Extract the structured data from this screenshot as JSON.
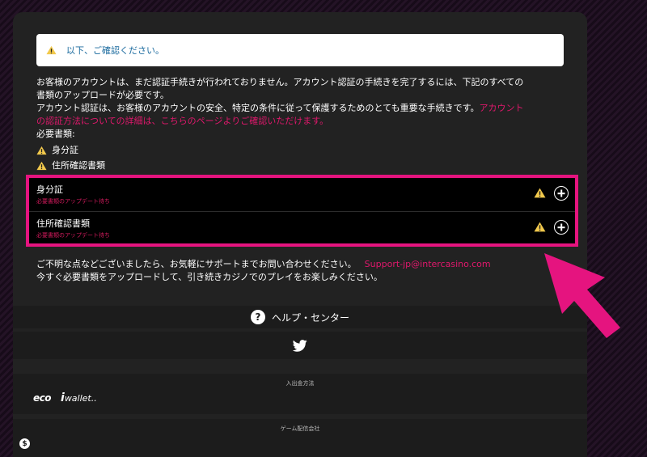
{
  "notice": {
    "text": "以下、ご確認ください。",
    "icon": "warning-icon"
  },
  "intro": {
    "line1": "お客様のアカウントは、まだ認証手続きが行われておりません。アカウント認証の手続きを完了するには、下記のすべての",
    "line2": "書類のアップロードが必要です。",
    "line3": "アカウント認証は、お客様のアカウントの安全、特定の条件に従って保護するためのとても重要な手続きです。",
    "link_part1": "アカウント",
    "link_part2": "の認証方法についての詳細は、こちらのページよりご確認いただけます。",
    "required_label": "必要書類:"
  },
  "required_docs": [
    "身分証",
    "住所確認書類"
  ],
  "upload_rows": [
    {
      "title": "身分証",
      "status": "必要書類のアップデート待ち"
    },
    {
      "title": "住所確認書類",
      "status": "必要書類のアップデート待ち"
    }
  ],
  "contact": {
    "line1": "ご不明な点などございましたら、お気軽にサポートまでお問い合わせください。",
    "email": "Support-jp@intercasino.com",
    "line2": "今すぐ必要書類をアップロードして、引き続きカジノでのプレイをお楽しみください。"
  },
  "footer": {
    "help_icon": "?",
    "help_label": "ヘルプ・センター",
    "payment_title": "入出金方法",
    "payment_logos": [
      "eco",
      "i",
      "wallet.."
    ],
    "game_title": "ゲーム配信会社",
    "game_icon": "$"
  },
  "colors": {
    "accent": "#e5147f",
    "warning": "#f2c94c",
    "link": "#e0186c",
    "notice_text": "#1a6a9e"
  }
}
